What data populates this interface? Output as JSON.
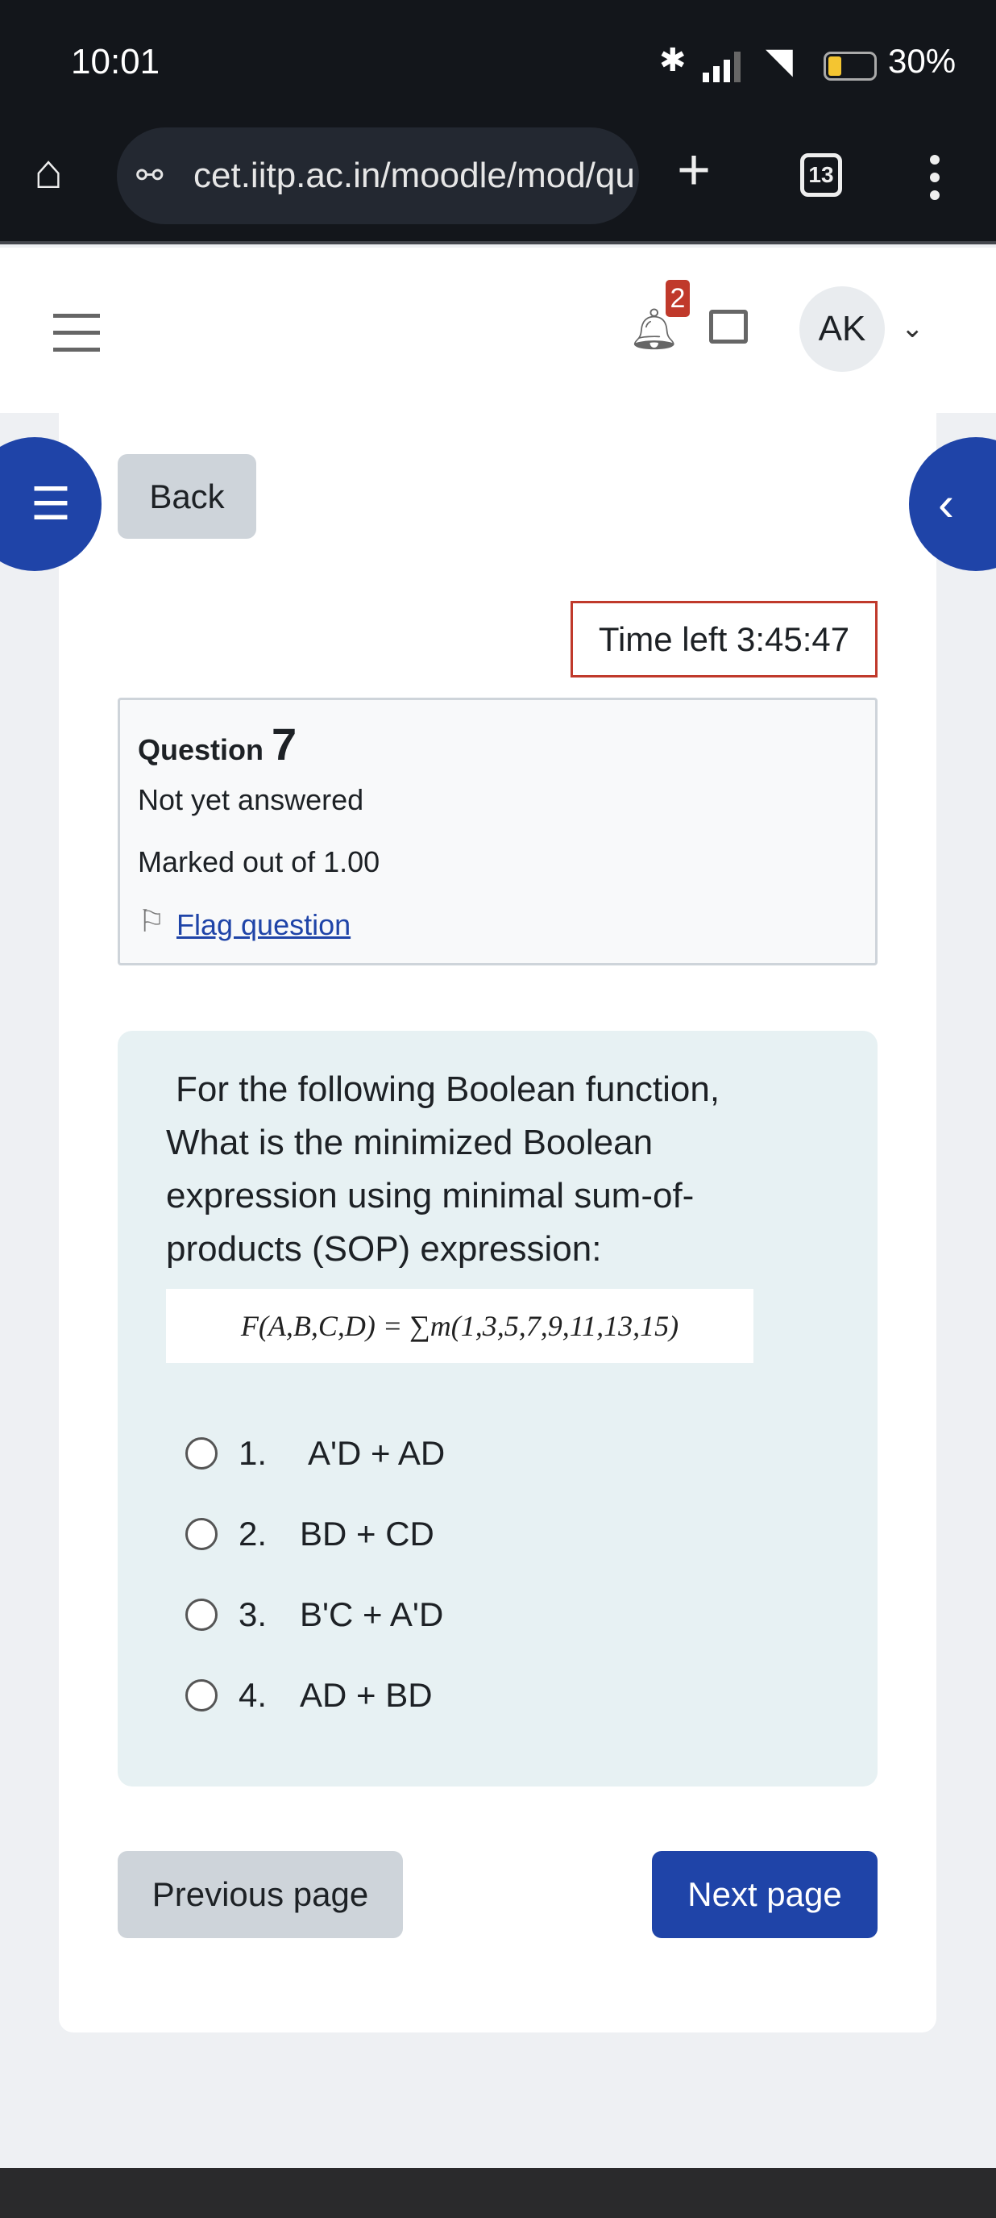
{
  "status_bar": {
    "time": "10:01",
    "battery": "30%",
    "battery_level": 0.3
  },
  "browser": {
    "url": "cet.iitp.ac.in/moodle/mod/qu",
    "tab_count": "13"
  },
  "header": {
    "notification_count": "2",
    "avatar_initials": "AK"
  },
  "page": {
    "back_label": "Back",
    "timer": "Time left 3:45:47",
    "question_info": {
      "label": "Question",
      "number": "7",
      "state": "Not yet answered",
      "marks": "Marked out of 1.00",
      "flag_label": "Flag question"
    },
    "question_text": "For the following Boolean function, What is the minimized Boolean expression using minimal sum-of-products (SOP) expression:",
    "formula": "F(A,B,C,D) = ∑m(1,3,5,7,9,11,13,15)",
    "options": [
      {
        "num": "1.",
        "text": "A'D + AD"
      },
      {
        "num": "2.",
        "text": "BD + CD"
      },
      {
        "num": "3.",
        "text": "B'C + A'D"
      },
      {
        "num": "4.",
        "text": "AD + BD"
      }
    ],
    "prev_label": "Previous page",
    "next_label": "Next page"
  },
  "colors": {
    "accent": "#1f44a8",
    "timer_border": "#c0392b",
    "badge": "#c0392b",
    "question_bg": "#e7f1f3"
  }
}
